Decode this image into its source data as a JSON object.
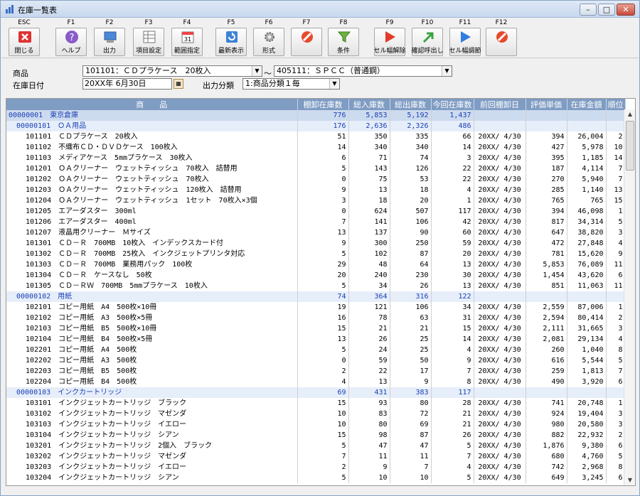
{
  "window": {
    "title": "在庫一覧表"
  },
  "toolbar": [
    {
      "key": "ESC",
      "label": "閉じる",
      "icon": "close-app-icon"
    },
    {
      "key": "F1",
      "label": "ヘルプ",
      "icon": "help-icon"
    },
    {
      "key": "F2",
      "label": "出力",
      "icon": "output-icon"
    },
    {
      "key": "F3",
      "label": "項目設定",
      "icon": "column-settings-icon"
    },
    {
      "key": "F4",
      "label": "範囲指定",
      "icon": "calendar-range-icon"
    },
    {
      "key": "F5",
      "label": "最新表示",
      "icon": "refresh-icon"
    },
    {
      "key": "F6",
      "label": "形式",
      "icon": "format-gear-icon"
    },
    {
      "key": "F7",
      "label": "",
      "icon": "disabled-icon"
    },
    {
      "key": "F8",
      "label": "条件",
      "icon": "filter-icon"
    },
    {
      "key": "F9",
      "label": "セル幅解除",
      "icon": "red-arrow-icon"
    },
    {
      "key": "F10",
      "label": "確認呼出し",
      "icon": "green-arrow-icon"
    },
    {
      "key": "F11",
      "label": "セル幅調節",
      "icon": "blue-arrow-icon"
    },
    {
      "key": "F12",
      "label": "",
      "icon": "disabled-icon"
    }
  ],
  "filters": {
    "product_label": "商品",
    "product_from": "101101：ＣＤプラケース　20枚入",
    "range_sep": "～",
    "product_to": "405111：ＳＰＣＣ（普通鋼）",
    "date_label": "在庫日付",
    "date_value": "20XX年 6月30日",
    "output_class_label": "出力分類",
    "output_class_value": "1:商品分類１毎"
  },
  "table": {
    "headers": [
      "商　　品",
      "棚卸在庫数",
      "総入庫数",
      "総出庫数",
      "今回在庫数",
      "前回棚卸日",
      "評価単価",
      "在庫金額",
      "順位"
    ],
    "rows": [
      {
        "type": "group1",
        "code": "00000001",
        "name": "東京倉庫",
        "c1": "776",
        "c2": "5,853",
        "c3": "5,192",
        "c4": "1,437",
        "c5": "",
        "c6": "",
        "c7": "",
        "c8": ""
      },
      {
        "type": "group2",
        "code": "00000101",
        "name": "ＯＡ用品",
        "c1": "176",
        "c2": "2,636",
        "c3": "2,326",
        "c4": "486",
        "c5": "",
        "c6": "",
        "c7": "",
        "c8": ""
      },
      {
        "type": "item",
        "code": "101101",
        "name": "ＣＤプラケース　20枚入",
        "c1": "51",
        "c2": "350",
        "c3": "335",
        "c4": "66",
        "c5": "20XX/ 4/30",
        "c6": "394",
        "c7": "26,004",
        "c8": "2"
      },
      {
        "type": "item",
        "code": "101102",
        "name": "不織布ＣＤ・ＤＶＤケース　100枚入",
        "c1": "14",
        "c2": "340",
        "c3": "340",
        "c4": "14",
        "c5": "20XX/ 4/30",
        "c6": "427",
        "c7": "5,978",
        "c8": "10"
      },
      {
        "type": "item",
        "code": "101103",
        "name": "メディアケース　5mmプラケース　30枚入",
        "c1": "6",
        "c2": "71",
        "c3": "74",
        "c4": "3",
        "c5": "20XX/ 4/30",
        "c6": "395",
        "c7": "1,185",
        "c8": "14"
      },
      {
        "type": "item",
        "code": "101201",
        "name": "ＯＡクリーナー　ウェットティッシュ　70枚入　詰替用",
        "c1": "5",
        "c2": "143",
        "c3": "126",
        "c4": "22",
        "c5": "20XX/ 4/30",
        "c6": "187",
        "c7": "4,114",
        "c8": "7"
      },
      {
        "type": "item",
        "code": "101202",
        "name": "ＯＡクリーナー　ウェットティッシュ　70枚入",
        "c1": "0",
        "c2": "75",
        "c3": "53",
        "c4": "22",
        "c5": "20XX/ 4/30",
        "c6": "270",
        "c7": "5,940",
        "c8": "7"
      },
      {
        "type": "item",
        "code": "101203",
        "name": "ＯＡクリーナー　ウェットティッシュ　120枚入　詰替用",
        "c1": "9",
        "c2": "13",
        "c3": "18",
        "c4": "4",
        "c5": "20XX/ 4/30",
        "c6": "285",
        "c7": "1,140",
        "c8": "13"
      },
      {
        "type": "item",
        "code": "101204",
        "name": "ＯＡクリーナー　ウェットティッシュ　1セット　70枚入×3個",
        "c1": "3",
        "c2": "18",
        "c3": "20",
        "c4": "1",
        "c5": "20XX/ 4/30",
        "c6": "765",
        "c7": "765",
        "c8": "15"
      },
      {
        "type": "item",
        "code": "101205",
        "name": "エアーダスター　300ml",
        "c1": "0",
        "c2": "624",
        "c3": "507",
        "c4": "117",
        "c5": "20XX/ 4/30",
        "c6": "394",
        "c7": "46,098",
        "c8": "1"
      },
      {
        "type": "item",
        "code": "101206",
        "name": "エアーダスター　400ml",
        "c1": "7",
        "c2": "141",
        "c3": "106",
        "c4": "42",
        "c5": "20XX/ 4/30",
        "c6": "817",
        "c7": "34,314",
        "c8": "5"
      },
      {
        "type": "item",
        "code": "101207",
        "name": "液晶用クリーナー　Ｍサイズ",
        "c1": "13",
        "c2": "137",
        "c3": "90",
        "c4": "60",
        "c5": "20XX/ 4/30",
        "c6": "647",
        "c7": "38,820",
        "c8": "3"
      },
      {
        "type": "item",
        "code": "101301",
        "name": "ＣＤ－Ｒ　700MB　10枚入　インデックスカード付",
        "c1": "9",
        "c2": "300",
        "c3": "250",
        "c4": "59",
        "c5": "20XX/ 4/30",
        "c6": "472",
        "c7": "27,848",
        "c8": "4"
      },
      {
        "type": "item",
        "code": "101302",
        "name": "ＣＤ－Ｒ　700MB　25枚入　インクジェットプリンタ対応",
        "c1": "5",
        "c2": "102",
        "c3": "87",
        "c4": "20",
        "c5": "20XX/ 4/30",
        "c6": "781",
        "c7": "15,620",
        "c8": "9"
      },
      {
        "type": "item",
        "code": "101303",
        "name": "ＣＤ－Ｒ　700MB　業務用パック　100枚",
        "c1": "29",
        "c2": "48",
        "c3": "64",
        "c4": "13",
        "c5": "20XX/ 4/30",
        "c6": "5,853",
        "c7": "76,089",
        "c8": "11"
      },
      {
        "type": "item",
        "code": "101304",
        "name": "ＣＤ－Ｒ　ケースなし　50枚",
        "c1": "20",
        "c2": "240",
        "c3": "230",
        "c4": "30",
        "c5": "20XX/ 4/30",
        "c6": "1,454",
        "c7": "43,620",
        "c8": "6"
      },
      {
        "type": "item",
        "code": "101305",
        "name": "ＣＤ－ＲＷ　700MB　5mmプラケース　10枚入",
        "c1": "5",
        "c2": "34",
        "c3": "26",
        "c4": "13",
        "c5": "20XX/ 4/30",
        "c6": "851",
        "c7": "11,063",
        "c8": "11"
      },
      {
        "type": "group2",
        "code": "00000102",
        "name": "用紙",
        "c1": "74",
        "c2": "364",
        "c3": "316",
        "c4": "122",
        "c5": "",
        "c6": "",
        "c7": "",
        "c8": ""
      },
      {
        "type": "item",
        "code": "102101",
        "name": "コピー用紙　A4　500枚×10冊",
        "c1": "19",
        "c2": "121",
        "c3": "106",
        "c4": "34",
        "c5": "20XX/ 4/30",
        "c6": "2,559",
        "c7": "87,006",
        "c8": "1"
      },
      {
        "type": "item",
        "code": "102102",
        "name": "コピー用紙　A3　500枚×5冊",
        "c1": "16",
        "c2": "78",
        "c3": "63",
        "c4": "31",
        "c5": "20XX/ 4/30",
        "c6": "2,594",
        "c7": "80,414",
        "c8": "2"
      },
      {
        "type": "item",
        "code": "102103",
        "name": "コピー用紙　B5　500枚×10冊",
        "c1": "15",
        "c2": "21",
        "c3": "21",
        "c4": "15",
        "c5": "20XX/ 4/30",
        "c6": "2,111",
        "c7": "31,665",
        "c8": "3"
      },
      {
        "type": "item",
        "code": "102104",
        "name": "コピー用紙　B4　500枚×5冊",
        "c1": "13",
        "c2": "26",
        "c3": "25",
        "c4": "14",
        "c5": "20XX/ 4/30",
        "c6": "2,081",
        "c7": "29,134",
        "c8": "4"
      },
      {
        "type": "item",
        "code": "102201",
        "name": "コピー用紙　A4　500枚",
        "c1": "5",
        "c2": "24",
        "c3": "25",
        "c4": "4",
        "c5": "20XX/ 4/30",
        "c6": "260",
        "c7": "1,040",
        "c8": "8"
      },
      {
        "type": "item",
        "code": "102202",
        "name": "コピー用紙　A3　500枚",
        "c1": "0",
        "c2": "59",
        "c3": "50",
        "c4": "9",
        "c5": "20XX/ 4/30",
        "c6": "616",
        "c7": "5,544",
        "c8": "5"
      },
      {
        "type": "item",
        "code": "102203",
        "name": "コピー用紙　B5　500枚",
        "c1": "2",
        "c2": "22",
        "c3": "17",
        "c4": "7",
        "c5": "20XX/ 4/30",
        "c6": "259",
        "c7": "1,813",
        "c8": "7"
      },
      {
        "type": "item",
        "code": "102204",
        "name": "コピー用紙　B4　500枚",
        "c1": "4",
        "c2": "13",
        "c3": "9",
        "c4": "8",
        "c5": "20XX/ 4/30",
        "c6": "490",
        "c7": "3,920",
        "c8": "6"
      },
      {
        "type": "group2",
        "code": "00000103",
        "name": "インクカートリッジ",
        "c1": "69",
        "c2": "431",
        "c3": "383",
        "c4": "117",
        "c5": "",
        "c6": "",
        "c7": "",
        "c8": ""
      },
      {
        "type": "item",
        "code": "103101",
        "name": "インクジェットカートリッジ　ブラック",
        "c1": "15",
        "c2": "93",
        "c3": "80",
        "c4": "28",
        "c5": "20XX/ 4/30",
        "c6": "741",
        "c7": "20,748",
        "c8": "1"
      },
      {
        "type": "item",
        "code": "103102",
        "name": "インクジェットカートリッジ　マゼンダ",
        "c1": "10",
        "c2": "83",
        "c3": "72",
        "c4": "21",
        "c5": "20XX/ 4/30",
        "c6": "924",
        "c7": "19,404",
        "c8": "3"
      },
      {
        "type": "item",
        "code": "103103",
        "name": "インクジェットカートリッジ　イエロー",
        "c1": "10",
        "c2": "80",
        "c3": "69",
        "c4": "21",
        "c5": "20XX/ 4/30",
        "c6": "980",
        "c7": "20,580",
        "c8": "3"
      },
      {
        "type": "item",
        "code": "103104",
        "name": "インクジェットカートリッジ　シアン",
        "c1": "15",
        "c2": "98",
        "c3": "87",
        "c4": "26",
        "c5": "20XX/ 4/30",
        "c6": "882",
        "c7": "22,932",
        "c8": "2"
      },
      {
        "type": "item",
        "code": "103201",
        "name": "インクジェットカートリッジ　2個入　ブラック",
        "c1": "5",
        "c2": "47",
        "c3": "47",
        "c4": "5",
        "c5": "20XX/ 4/30",
        "c6": "1,876",
        "c7": "9,380",
        "c8": "6"
      },
      {
        "type": "item",
        "code": "103202",
        "name": "インクジェットカートリッジ　マゼンダ",
        "c1": "7",
        "c2": "11",
        "c3": "11",
        "c4": "7",
        "c5": "20XX/ 4/30",
        "c6": "680",
        "c7": "4,760",
        "c8": "5"
      },
      {
        "type": "item",
        "code": "103203",
        "name": "インクジェットカートリッジ　イエロー",
        "c1": "2",
        "c2": "9",
        "c3": "7",
        "c4": "4",
        "c5": "20XX/ 4/30",
        "c6": "742",
        "c7": "2,968",
        "c8": "8"
      },
      {
        "type": "item",
        "code": "103204",
        "name": "インクジェットカートリッジ　シアン",
        "c1": "5",
        "c2": "10",
        "c3": "10",
        "c4": "5",
        "c5": "20XX/ 4/30",
        "c6": "649",
        "c7": "3,245",
        "c8": "6"
      }
    ]
  }
}
